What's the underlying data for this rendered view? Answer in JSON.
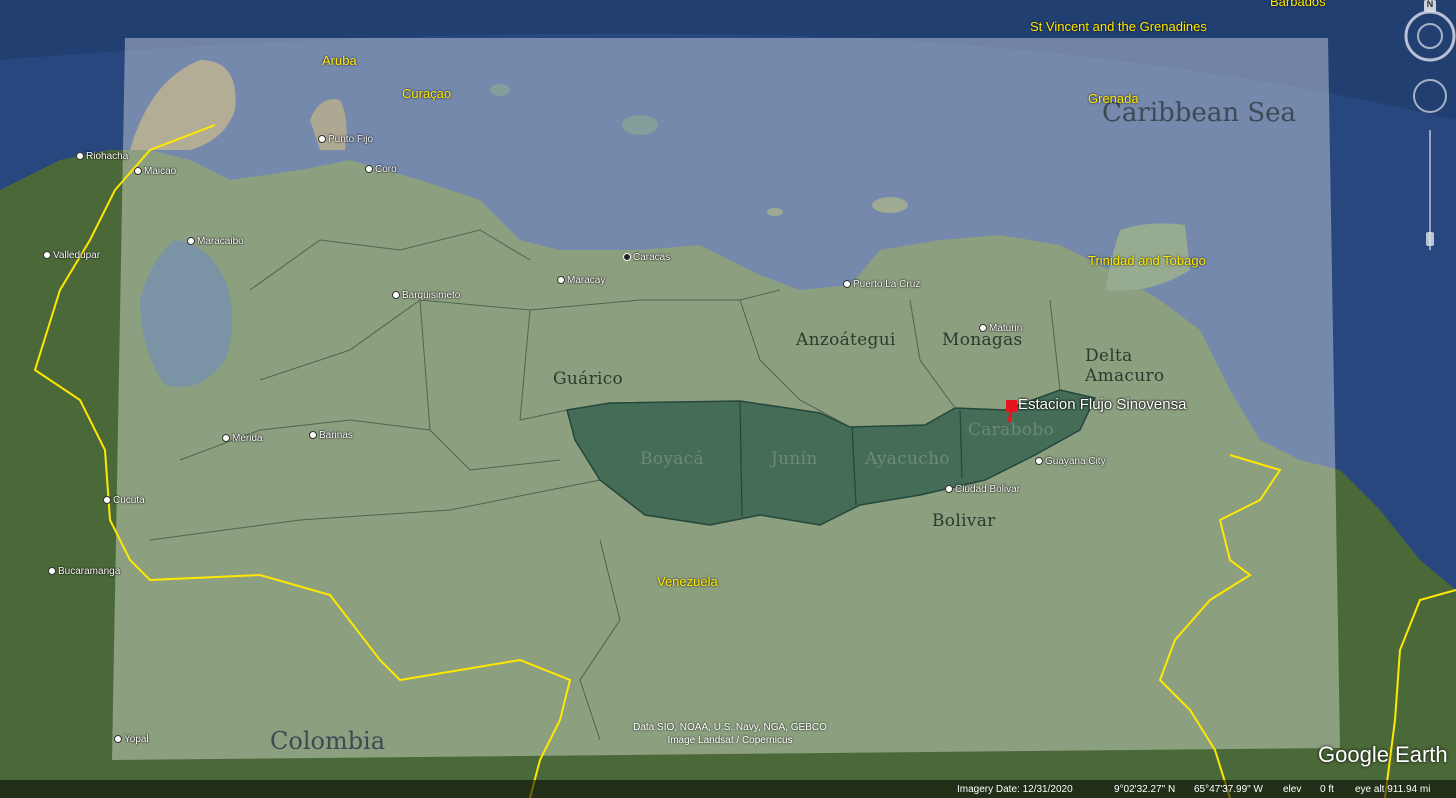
{
  "map": {
    "seas": {
      "caribbean": "Caribbean Sea"
    },
    "countries": {
      "venezuela": "Venezuela",
      "colombia": "Colombia"
    },
    "islands": {
      "aruba": "Aruba",
      "curacao": "Curaçao",
      "grenada": "Grenada",
      "svg": "St Vincent and the Grenadines",
      "trinidad": "Trinidad and Tobago",
      "barbados": "Barbados"
    },
    "cities": {
      "riohacha": "Riohacha",
      "maicao": "Maicao",
      "valledupar": "Valledupar",
      "maracaibo": "Maracaibo",
      "punto_fijo": "Punto Fijo",
      "coro": "Coro",
      "caracas": "Caracas",
      "maracay": "Maracay",
      "barquisimeto": "Barquisimeto",
      "puerto_la_cruz": "Puerto La Cruz",
      "maturin": "Maturin",
      "merida": "Merida",
      "barinas": "Barinas",
      "cucuta": "Cucuta",
      "bucaramanga": "Bucaramanga",
      "yopal": "Yopal",
      "guayana": "Guayana City",
      "ciudad_bolivar": "Ciudad Bolivar"
    },
    "regions": {
      "guarico": "Guárico",
      "anzoategui": "Anzoátegui",
      "monagas": "Monagas",
      "delta_amacuro": [
        "Delta",
        "Amacuro"
      ],
      "bolivar": "Bolivar",
      "boyaca": "Boyacá",
      "junin": "Junín",
      "ayacucho": "Ayacucho",
      "carabobo": "Carabobo"
    },
    "marker": "Estacion Flujo Sinovensa"
  },
  "credits": [
    "Data SIO, NOAA, U.S. Navy, NGA, GEBCO",
    "Image Landsat / Copernicus"
  ],
  "logo": "Google Earth",
  "status": {
    "imagery_date": "Imagery Date: 12/31/2020",
    "lat": "9°02'32.27\" N",
    "lon": "65°47'37.99\" W",
    "elev": "elev",
    "elev_val": "0 ft",
    "eye_alt": "eye alt 911.94 mi"
  },
  "colors": {
    "sea": "#2b4f8a",
    "land": "#4d6a3a",
    "overlay": "#ffffff",
    "belt": "#3f6a5c",
    "border": "#ffe800",
    "marker": "#e8141c"
  },
  "nav": {
    "north_label": "N"
  }
}
